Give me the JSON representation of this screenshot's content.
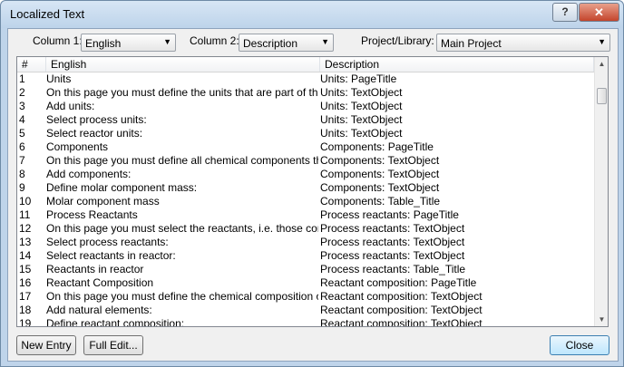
{
  "window": {
    "title": "Localized Text"
  },
  "titlebar_buttons": {
    "help": "?",
    "close": "✕"
  },
  "toolbar": {
    "column1_label": "Column 1:",
    "column1_value": "English",
    "column2_label": "Column 2:",
    "column2_value": "Description",
    "project_label": "Project/Library:",
    "project_value": "Main Project"
  },
  "table": {
    "headers": [
      "#",
      "English",
      "Description"
    ],
    "rows": [
      [
        "1",
        "Units",
        "Units: PageTitle"
      ],
      [
        "2",
        "On this page you must define the units that are part of the process",
        "Units: TextObject"
      ],
      [
        "3",
        "Add units:",
        "Units: TextObject"
      ],
      [
        "4",
        "Select process units:",
        "Units: TextObject"
      ],
      [
        "5",
        "Select reactor units:",
        "Units: TextObject"
      ],
      [
        "6",
        "Components",
        "Components: PageTitle"
      ],
      [
        "7",
        "On this page you must define all chemical components that are part",
        "Components: TextObject"
      ],
      [
        "8",
        "Add components:",
        "Components: TextObject"
      ],
      [
        "9",
        "Define molar component mass:",
        "Components: TextObject"
      ],
      [
        "10",
        "Molar component mass",
        "Components: Table_Title"
      ],
      [
        "11",
        "Process Reactants",
        "Process reactants: PageTitle"
      ],
      [
        "12",
        "On this page you must select the reactants, i.e. those components",
        "Process reactants: TextObject"
      ],
      [
        "13",
        "Select process reactants:",
        "Process reactants: TextObject"
      ],
      [
        "14",
        "Select reactants in reactor:",
        "Process reactants: TextObject"
      ],
      [
        "15",
        "Reactants in reactor",
        "Process reactants: Table_Title"
      ],
      [
        "16",
        "Reactant Composition",
        "Reactant composition: PageTitle"
      ],
      [
        "17",
        "On this page you must define the chemical composition of all reactants",
        "Reactant composition: TextObject"
      ],
      [
        "18",
        "Add natural elements:",
        "Reactant composition: TextObject"
      ],
      [
        "19",
        "Define reactant composition:",
        "Reactant composition: TextObject"
      ]
    ]
  },
  "scrollbar": {
    "up": "▲",
    "down": "▼"
  },
  "footer": {
    "new_entry": "New Entry",
    "full_edit": "Full Edit...",
    "close": "Close"
  }
}
